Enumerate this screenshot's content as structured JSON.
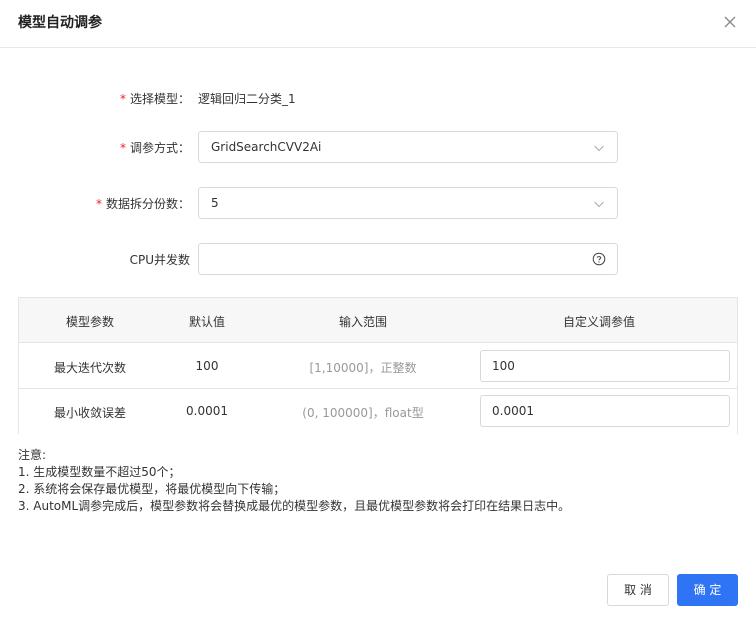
{
  "dialog": {
    "title": "模型自动调参",
    "close_icon": "close-icon"
  },
  "form": {
    "model": {
      "label": "选择模型：",
      "value": "逻辑回归二分类_1",
      "required": true
    },
    "method": {
      "label": "调参方式：",
      "value": "GridSearchCVV2Ai",
      "required": true
    },
    "folds": {
      "label": "数据拆分份数：",
      "value": "5",
      "required": true
    },
    "cpu": {
      "label": "CPU并发数",
      "value": "",
      "required": false
    },
    "required_mark": "*"
  },
  "table": {
    "headers": [
      "模型参数",
      "默认值",
      "输入范围",
      "自定义调参值"
    ],
    "rows": [
      {
        "param": "最大迭代次数",
        "default": "100",
        "range": "[1,10000]，正整数",
        "custom": "100"
      },
      {
        "param": "最小收敛误差",
        "default": "0.0001",
        "range": "(0, 100000]，float型",
        "custom": "0.0001"
      }
    ]
  },
  "notes": {
    "title": "注意:",
    "items": [
      "1. 生成模型数量不超过50个；",
      "2. 系统将会保存最优模型，将最优模型向下传输；",
      "3. AutoML调参完成后，模型参数将会替换成最优的模型参数，且最优模型参数将会打印在结果日志中。"
    ]
  },
  "footer": {
    "cancel_label": "取 消",
    "ok_label": "确 定"
  },
  "colors": {
    "primary": "#2f74f5",
    "required": "#f5222d"
  }
}
